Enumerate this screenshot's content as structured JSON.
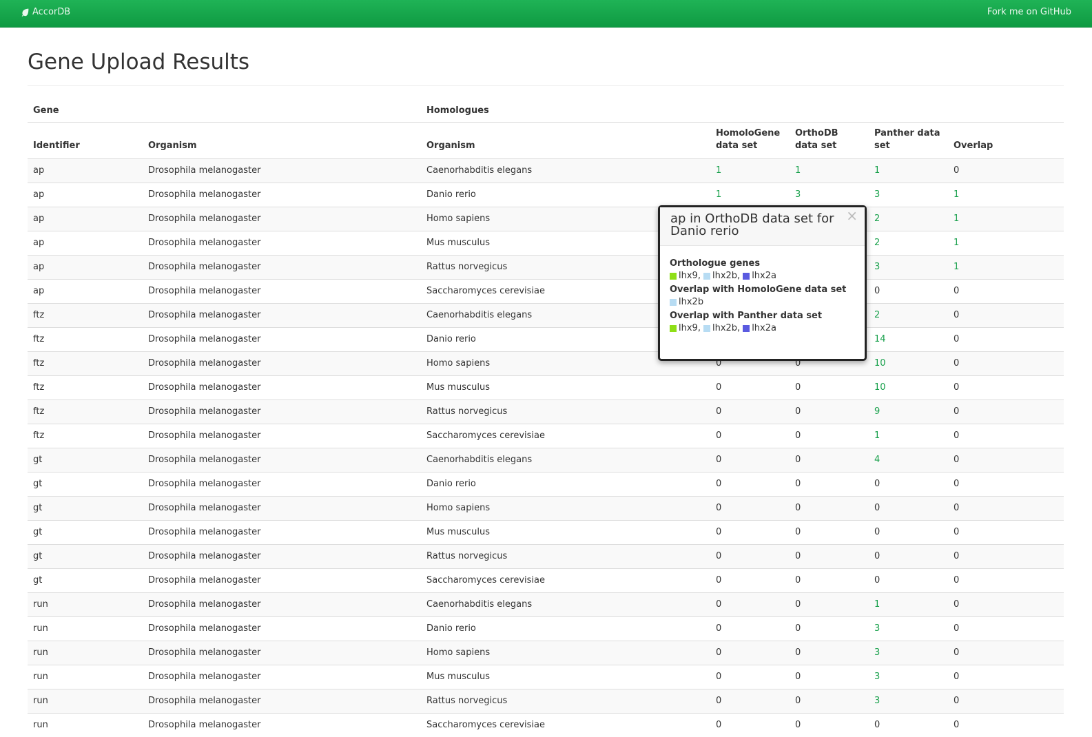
{
  "navbar": {
    "brand": "AccorDB",
    "fork_link": "Fork me on GitHub"
  },
  "page": {
    "title": "Gene Upload Results"
  },
  "table": {
    "group_headers": {
      "gene": "Gene",
      "homologues": "Homologues"
    },
    "columns": {
      "identifier": "Identifier",
      "gene_organism": "Organism",
      "homolog_organism": "Organism",
      "homologene": "HomoloGene data set",
      "orthodb": "OrthoDB data set",
      "panther": "Panther data set",
      "overlap": "Overlap"
    },
    "rows": [
      [
        "ap",
        "Drosophila melanogaster",
        "Caenorhabditis elegans",
        "1",
        "1",
        "1",
        "0"
      ],
      [
        "ap",
        "Drosophila melanogaster",
        "Danio rerio",
        "1",
        "3",
        "3",
        "1"
      ],
      [
        "ap",
        "Drosophila melanogaster",
        "Homo sapiens",
        "",
        "",
        "2",
        "1"
      ],
      [
        "ap",
        "Drosophila melanogaster",
        "Mus musculus",
        "",
        "",
        "2",
        "1"
      ],
      [
        "ap",
        "Drosophila melanogaster",
        "Rattus norvegicus",
        "",
        "",
        "3",
        "1"
      ],
      [
        "ap",
        "Drosophila melanogaster",
        "Saccharomyces cerevisiae",
        "",
        "",
        "0",
        "0"
      ],
      [
        "ftz",
        "Drosophila melanogaster",
        "Caenorhabditis elegans",
        "",
        "",
        "2",
        "0"
      ],
      [
        "ftz",
        "Drosophila melanogaster",
        "Danio rerio",
        "",
        "",
        "14",
        "0"
      ],
      [
        "ftz",
        "Drosophila melanogaster",
        "Homo sapiens",
        "0",
        "0",
        "10",
        "0"
      ],
      [
        "ftz",
        "Drosophila melanogaster",
        "Mus musculus",
        "0",
        "0",
        "10",
        "0"
      ],
      [
        "ftz",
        "Drosophila melanogaster",
        "Rattus norvegicus",
        "0",
        "0",
        "9",
        "0"
      ],
      [
        "ftz",
        "Drosophila melanogaster",
        "Saccharomyces cerevisiae",
        "0",
        "0",
        "1",
        "0"
      ],
      [
        "gt",
        "Drosophila melanogaster",
        "Caenorhabditis elegans",
        "0",
        "0",
        "4",
        "0"
      ],
      [
        "gt",
        "Drosophila melanogaster",
        "Danio rerio",
        "0",
        "0",
        "0",
        "0"
      ],
      [
        "gt",
        "Drosophila melanogaster",
        "Homo sapiens",
        "0",
        "0",
        "0",
        "0"
      ],
      [
        "gt",
        "Drosophila melanogaster",
        "Mus musculus",
        "0",
        "0",
        "0",
        "0"
      ],
      [
        "gt",
        "Drosophila melanogaster",
        "Rattus norvegicus",
        "0",
        "0",
        "0",
        "0"
      ],
      [
        "gt",
        "Drosophila melanogaster",
        "Saccharomyces cerevisiae",
        "0",
        "0",
        "0",
        "0"
      ],
      [
        "run",
        "Drosophila melanogaster",
        "Caenorhabditis elegans",
        "0",
        "0",
        "1",
        "0"
      ],
      [
        "run",
        "Drosophila melanogaster",
        "Danio rerio",
        "0",
        "0",
        "3",
        "0"
      ],
      [
        "run",
        "Drosophila melanogaster",
        "Homo sapiens",
        "0",
        "0",
        "3",
        "0"
      ],
      [
        "run",
        "Drosophila melanogaster",
        "Mus musculus",
        "0",
        "0",
        "3",
        "0"
      ],
      [
        "run",
        "Drosophila melanogaster",
        "Rattus norvegicus",
        "0",
        "0",
        "3",
        "0"
      ],
      [
        "run",
        "Drosophila melanogaster",
        "Saccharomyces cerevisiae",
        "0",
        "0",
        "0",
        "0"
      ]
    ]
  },
  "popover": {
    "title": "ap in OrthoDB data set for Danio rerio",
    "close": "×",
    "sections": [
      {
        "heading": "Orthologue genes",
        "genes": [
          {
            "name": "lhx9",
            "color": "#8fdf17"
          },
          {
            "name": "lhx2b",
            "color": "#b7dcf3"
          },
          {
            "name": "lhx2a",
            "color": "#5a5ae0"
          }
        ]
      },
      {
        "heading": "Overlap with HomoloGene data set",
        "genes": [
          {
            "name": "lhx2b",
            "color": "#b7dcf3"
          }
        ]
      },
      {
        "heading": "Overlap with Panther data set",
        "genes": [
          {
            "name": "lhx9",
            "color": "#8fdf17"
          },
          {
            "name": "lhx2b",
            "color": "#b7dcf3"
          },
          {
            "name": "lhx2a",
            "color": "#5a5ae0"
          }
        ]
      }
    ]
  },
  "colors": {
    "navbar": "#14a84c",
    "link": "#19a14c"
  }
}
